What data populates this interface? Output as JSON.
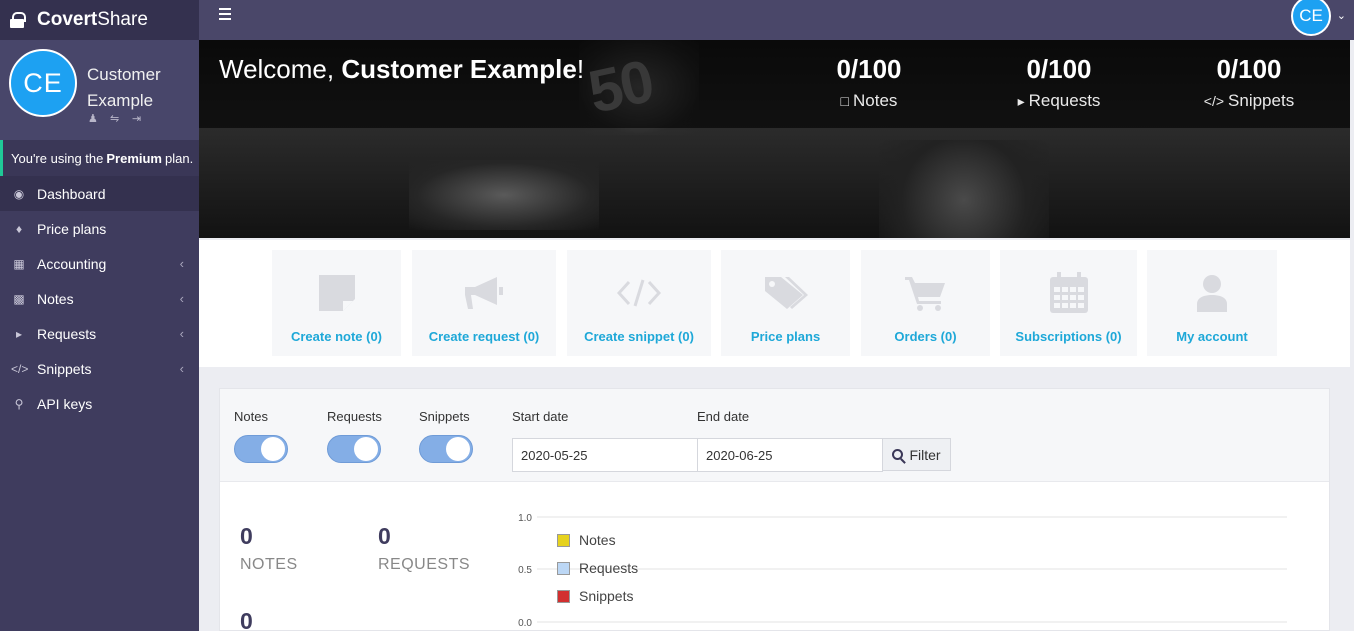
{
  "app": {
    "brand_bold": "Covert",
    "brand_light": "Share"
  },
  "user": {
    "initials": "CE",
    "name": "Customer Example"
  },
  "plan_notice": {
    "prefix": "You're using the",
    "plan": "Premium",
    "suffix": "plan."
  },
  "sidebar": {
    "items": [
      {
        "label": "Dashboard",
        "icon": "dashboard-icon",
        "active": true
      },
      {
        "label": "Price plans",
        "icon": "tags-icon"
      },
      {
        "label": "Accounting",
        "icon": "table-icon",
        "expandable": true
      },
      {
        "label": "Notes",
        "icon": "note-icon",
        "expandable": true
      },
      {
        "label": "Requests",
        "icon": "bullhorn-icon",
        "expandable": true
      },
      {
        "label": "Snippets",
        "icon": "code-icon",
        "expandable": true
      },
      {
        "label": "API keys",
        "icon": "key-icon"
      }
    ]
  },
  "hero": {
    "welcome_prefix": "Welcome, ",
    "welcome_name": "Customer Example",
    "welcome_suffix": "!",
    "stats": [
      {
        "value": "0/100",
        "label": "Notes",
        "icon": "note-icon"
      },
      {
        "value": "0/100",
        "label": "Requests",
        "icon": "bullhorn-icon"
      },
      {
        "value": "0/100",
        "label": "Snippets",
        "icon": "code-icon"
      }
    ]
  },
  "quick_actions": [
    {
      "label": "Create note (0)",
      "icon": "note-icon"
    },
    {
      "label": "Create request (0)",
      "icon": "bullhorn-icon"
    },
    {
      "label": "Create snippet (0)",
      "icon": "code-icon"
    },
    {
      "label": "Price plans",
      "icon": "tags-icon"
    },
    {
      "label": "Orders (0)",
      "icon": "cart-icon"
    },
    {
      "label": "Subscriptions (0)",
      "icon": "calendar-icon"
    },
    {
      "label": "My account",
      "icon": "user-icon"
    }
  ],
  "filters": {
    "toggles": [
      {
        "label": "Notes",
        "on": true
      },
      {
        "label": "Requests",
        "on": true
      },
      {
        "label": "Snippets",
        "on": true
      }
    ],
    "start_date_label": "Start date",
    "start_date": "2020-05-25",
    "end_date_label": "End date",
    "end_date": "2020-06-25",
    "filter_button": "Filter"
  },
  "kpis": [
    {
      "value": "0",
      "label": "NOTES"
    },
    {
      "value": "0",
      "label": "REQUESTS"
    },
    {
      "value": "0",
      "label": ""
    }
  ],
  "chart_data": {
    "type": "line",
    "series": [
      {
        "name": "Notes",
        "color": "#e6d21e",
        "values": []
      },
      {
        "name": "Requests",
        "color": "#bcd7f5",
        "values": []
      },
      {
        "name": "Snippets",
        "color": "#d22f2f",
        "values": []
      }
    ],
    "y_ticks": [
      "1.0",
      "0.5",
      "0.0"
    ],
    "ylim": [
      0,
      1
    ],
    "legend_position": "top-left"
  }
}
